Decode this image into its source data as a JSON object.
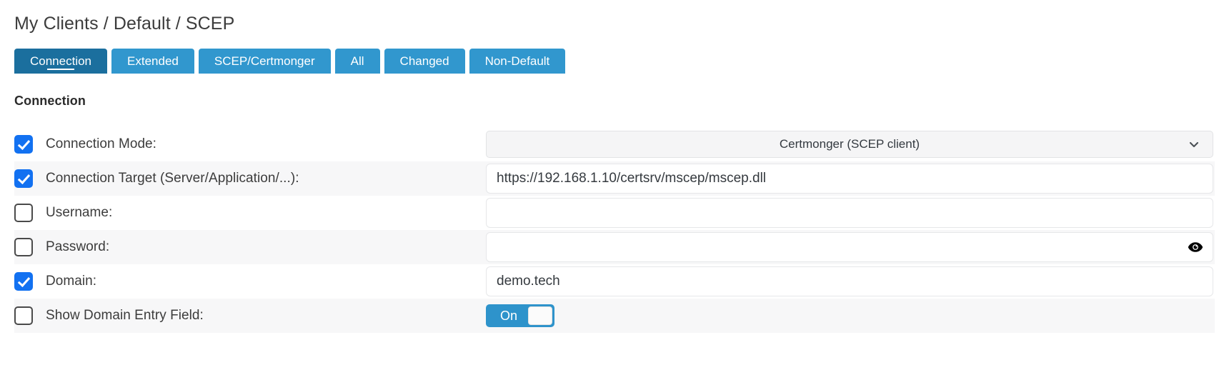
{
  "breadcrumb": "My Clients / Default / SCEP",
  "tabs": [
    {
      "label": "Connection",
      "active": true
    },
    {
      "label": "Extended",
      "active": false
    },
    {
      "label": "SCEP/Certmonger",
      "active": false
    },
    {
      "label": "All",
      "active": false
    },
    {
      "label": "Changed",
      "active": false
    },
    {
      "label": "Non-Default",
      "active": false
    }
  ],
  "section": {
    "title": "Connection"
  },
  "colors": {
    "tab_active": "#1b6f9e",
    "tab_inactive": "#3197ce",
    "checkbox_checked": "#1271f1",
    "toggle_on": "#2e93cb",
    "row_alt_background": "#f7f7f8",
    "select_background": "#f5f5f6"
  },
  "rows": [
    {
      "label": "Connection Mode:",
      "checked": true,
      "control": "select",
      "value": "Certmonger (SCEP client)",
      "placeholder": "",
      "alt": false
    },
    {
      "label": "Connection Target (Server/Application/...):",
      "checked": true,
      "control": "text",
      "value": "https://192.168.1.10/certsrv/mscep/mscep.dll",
      "placeholder": "",
      "alt": true
    },
    {
      "label": "Username:",
      "checked": false,
      "control": "text",
      "value": "",
      "placeholder": "",
      "alt": false
    },
    {
      "label": "Password:",
      "checked": false,
      "control": "password",
      "value": "",
      "placeholder": "",
      "alt": true
    },
    {
      "label": "Domain:",
      "checked": true,
      "control": "text",
      "value": "demo.tech",
      "placeholder": "",
      "alt": false
    },
    {
      "label": "Show Domain Entry Field:",
      "checked": false,
      "control": "toggle",
      "value": "On",
      "placeholder": "",
      "alt": true
    }
  ]
}
